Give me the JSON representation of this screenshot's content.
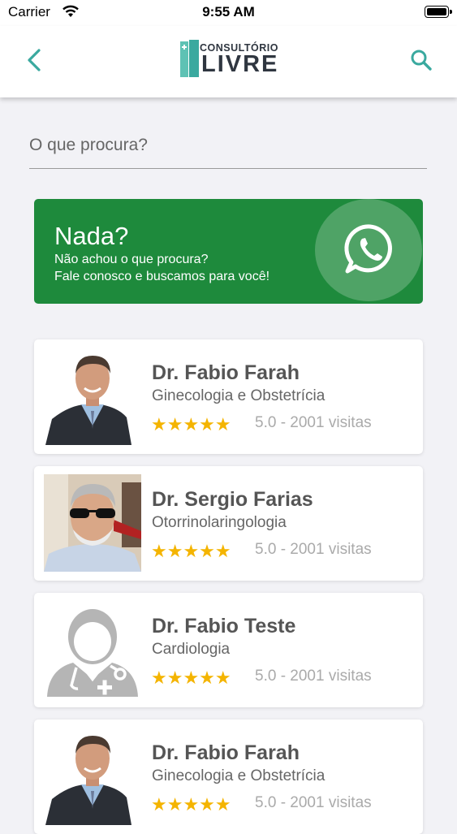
{
  "status_bar": {
    "carrier": "Carrier",
    "time": "9:55 AM",
    "wifi_icon": "wifi-icon",
    "battery_icon": "battery-icon"
  },
  "nav": {
    "back_icon": "chevron-left-icon",
    "search_icon": "search-icon",
    "logo_small": "CONSULTÓRIO",
    "logo_big": "LIVRE",
    "accent_color": "#3aa99f"
  },
  "search": {
    "placeholder": "O que procura?",
    "value": ""
  },
  "banner": {
    "title": "Nada?",
    "line1": "Não achou o que procura?",
    "line2": "Fale conosco e buscamos para você!",
    "icon": "whatsapp-icon",
    "color": "#1e8a3c"
  },
  "doctors": [
    {
      "name": "Dr. Fabio Farah",
      "specialty": "Ginecologia e Obstetrícia",
      "stars": "★★★★★",
      "rating": "5.0 - 2001 visitas"
    },
    {
      "name": "Dr. Sergio Farias",
      "specialty": "Otorrinolaringologia",
      "stars": "★★★★★",
      "rating": "5.0 - 2001 visitas"
    },
    {
      "name": "Dr. Fabio Teste",
      "specialty": "Cardiologia",
      "stars": "★★★★★",
      "rating": "5.0 - 2001 visitas"
    },
    {
      "name": "Dr. Fabio Farah",
      "specialty": "Ginecologia e Obstetrícia",
      "stars": "★★★★★",
      "rating": "5.0 - 2001 visitas"
    }
  ],
  "star_color": "#f4b400"
}
